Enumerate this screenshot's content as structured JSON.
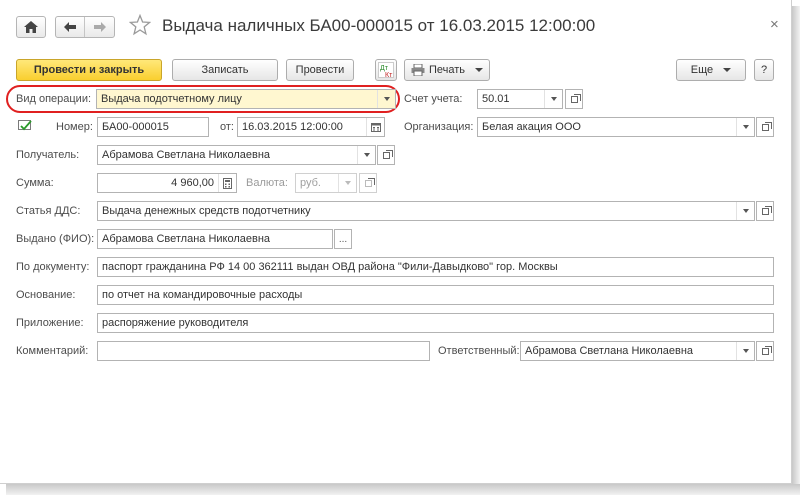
{
  "title": "Выдача наличных БА00-000015 от 16.03.2015 12:00:00",
  "toolbar": {
    "post_close": "Провести и закрыть",
    "save": "Записать",
    "post": "Провести",
    "print": "Печать",
    "more": "Еще",
    "help": "?"
  },
  "form": {
    "operation_label": "Вид операции:",
    "operation_value": "Выдача подотчетному лицу",
    "account_label": "Счет учета:",
    "account_value": "50.01",
    "number_label": "Номер:",
    "number_value": "БА00-000015",
    "date_label": "от:",
    "date_value": "16.03.2015 12:00:00",
    "org_label": "Организация:",
    "org_value": "Белая акация ООО",
    "recipient_label": "Получатель:",
    "recipient_value": "Абрамова Светлана Николаевна",
    "amount_label": "Сумма:",
    "amount_value": "4 960,00",
    "currency_label": "Валюта:",
    "currency_value": "руб.",
    "dds_label": "Статья ДДС:",
    "dds_value": "Выдача денежных средств подотчетнику",
    "issued_label": "Выдано (ФИО):",
    "issued_value": "Абрамова Светлана Николаевна",
    "doc_label": "По документу:",
    "doc_value": "паспорт гражданина РФ 14 00 362111 выдан ОВД района \"Фили-Давыдково\" гор. Москвы",
    "basis_label": "Основание:",
    "basis_value": "по отчет на командировочные расходы",
    "attach_label": "Приложение:",
    "attach_value": "распоряжение руководителя",
    "comment_label": "Комментарий:",
    "comment_value": "",
    "responsible_label": "Ответственный:",
    "responsible_value": "Абрамова Светлана Николаевна",
    "more_btn": "..."
  },
  "icons": {
    "home": "home-icon",
    "back": "arrow-left-icon",
    "forward": "arrow-right-icon",
    "favorite": "star-icon",
    "close": "close-icon",
    "dt_kt": "dt-kt-icon",
    "printer": "printer-icon",
    "posted": "posted-status-icon",
    "calendar": "calendar-icon",
    "calculator": "calculator-icon"
  },
  "colors": {
    "primary_button": "#f9cf2f",
    "highlight": "#e02020"
  }
}
